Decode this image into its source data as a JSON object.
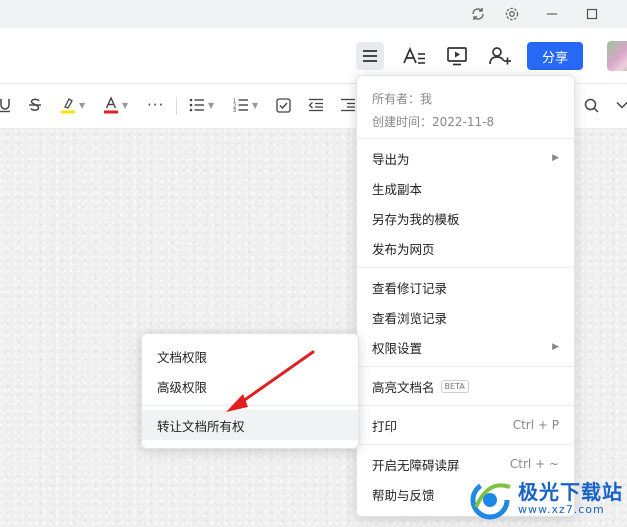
{
  "titlebar": {
    "icons": [
      "sync-icon",
      "gear-icon",
      "minimize-icon",
      "maximize-icon"
    ]
  },
  "header": {
    "icons": [
      "menu-icon",
      "font-format-icon",
      "present-icon",
      "add-collaborator-icon"
    ],
    "share_label": "分享"
  },
  "toolbar": {
    "more": "···"
  },
  "main_menu": {
    "owner": "所有者：我",
    "created": "创建时间：2022-11-8",
    "items": [
      {
        "label": "导出为",
        "submenu": true
      },
      {
        "label": "生成副本"
      },
      {
        "label": "另存为我的模板"
      },
      {
        "label": "发布为网页"
      },
      {
        "label": "查看修订记录"
      },
      {
        "label": "查看浏览记录"
      },
      {
        "label": "权限设置",
        "submenu": true
      },
      {
        "label": "高亮文档名",
        "badge": "BETA"
      },
      {
        "label": "打印",
        "shortcut": "Ctrl + P"
      },
      {
        "label": "开启无障碍读屏",
        "shortcut": "Ctrl + ~"
      },
      {
        "label": "帮助与反馈"
      }
    ]
  },
  "sub_menu": {
    "items": [
      {
        "label": "文档权限"
      },
      {
        "label": "高级权限"
      },
      {
        "label": "转让文档所有权"
      }
    ]
  },
  "watermark": {
    "text": "极光下载站",
    "url": "www.xz7.com"
  },
  "colors": {
    "accent": "#2768f5",
    "highlight": "#f5e400",
    "font_color": "#e02020",
    "annotation": "#e02020"
  }
}
